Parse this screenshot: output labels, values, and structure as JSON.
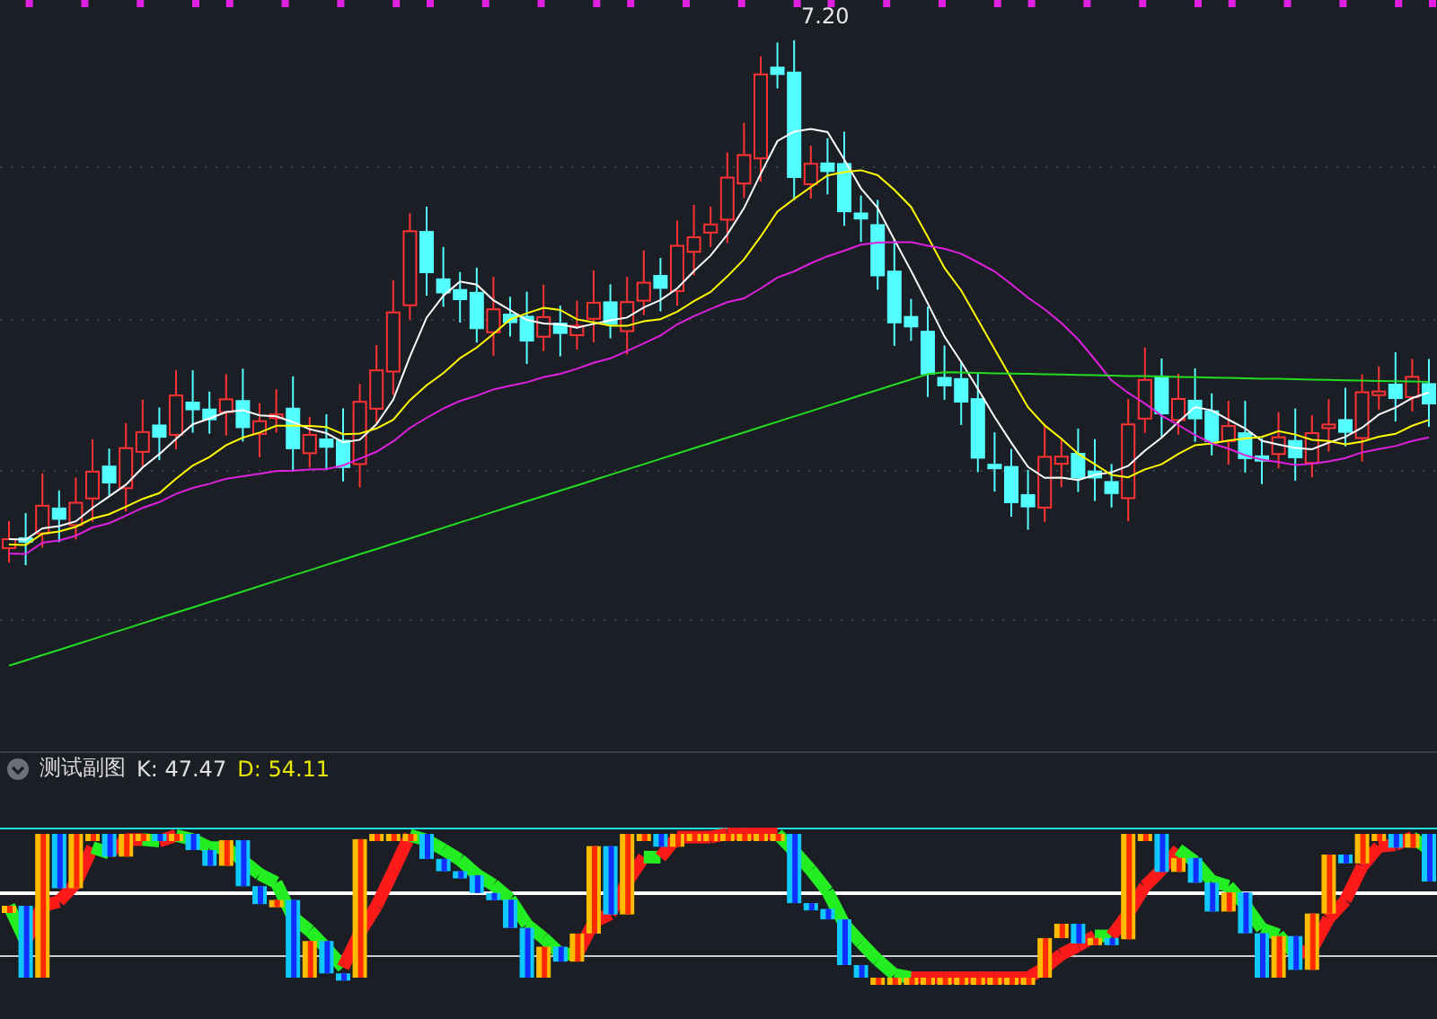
{
  "main_chart": {
    "high_label": "7.20"
  },
  "indicator_panel": {
    "title": "测试副图",
    "k_reading": "K: 47.47",
    "d_reading": "D: 54.11"
  }
}
